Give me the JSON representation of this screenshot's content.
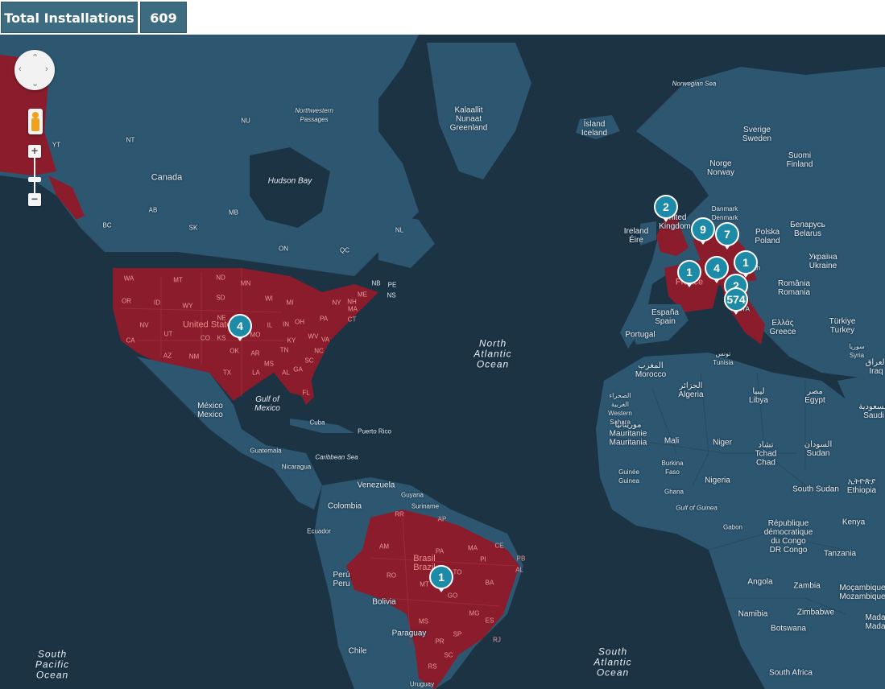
{
  "header": {
    "label": "Total Installations",
    "value": "609"
  },
  "colors": {
    "ocean": "#1c3344",
    "land": "#2d5770",
    "highlight": "#8a1c2c",
    "header_box": "#3d6c80",
    "marker": "#1d8aa8"
  },
  "map_controls": {
    "icons": [
      "pan-icon",
      "pegman-icon",
      "zoom-in-icon",
      "zoom-out-icon"
    ],
    "zoom_in": "+",
    "zoom_out": "−"
  },
  "markers": [
    {
      "name": "united-kingdom",
      "count": "2"
    },
    {
      "name": "netherlands",
      "count": "9"
    },
    {
      "name": "germany",
      "count": "7"
    },
    {
      "name": "france",
      "count": "1"
    },
    {
      "name": "switzerland",
      "count": "4"
    },
    {
      "name": "austria",
      "count": "1"
    },
    {
      "name": "italy-north",
      "count": "2"
    },
    {
      "name": "italy",
      "count": "574"
    },
    {
      "name": "united-states",
      "count": "4"
    },
    {
      "name": "brazil",
      "count": "1"
    }
  ],
  "labels": {
    "norwegian_sea": "Norwegian Sea",
    "northwestern_passages": "Northwestern\nPassages",
    "nu": "NU",
    "nt": "NT",
    "yt": "YT",
    "greenland": "Kalaallit\nNunaat\nGreenland",
    "iceland": "Ísland\nIceland",
    "sweden": "Sverige\nSweden",
    "norway": "Norge\nNorway",
    "finland": "Suomi\nFinland",
    "canada": "Canada",
    "hudson_bay": "Hudson Bay",
    "ab": "AB",
    "mb": "MB",
    "sk": "SK",
    "bc": "BC",
    "nl": "NL",
    "on": "ON",
    "qc": "QC",
    "nb": "NB",
    "pe": "PE",
    "ns": "NS",
    "denmark": "Danmark\nDenmark",
    "ireland": "Ireland\nÉire",
    "united_kingdom": "United\nKingdom",
    "poland": "Polska\nPoland",
    "belarus": "Беларусь\nBelarus",
    "ukraine": "Україна\nUkraine",
    "romania": "România\nRomania",
    "greece": "Ελλάς\nGreece",
    "turkey": "Türkiye\nTurkey",
    "spain": "España\nSpain",
    "portugal": "Portugal",
    "france": "France",
    "tunisia": "تونس\nTunisia",
    "morocco": "المغرب\nMorocco",
    "algeria": "الجزائر\nAlgeria",
    "libya": "ليبيا\nLibya",
    "egypt": "مصر\nEgypt",
    "syria": "سوريا\nSyria",
    "iraq": "العراق\nIraq",
    "saudi": "السعودية\nSaudi",
    "western_sahara": "الصحراء\nالغربية\nWestern\nSahara",
    "mauritania": "موريتانيا\nMauritanie\nMauritania",
    "mali": "Mali",
    "niger": "Niger",
    "chad": "تشاد\nTchad\nChad",
    "sudan": "السودان\nSudan",
    "ethiopia": "ኢትዮጵያ\nEthiopia",
    "south_sudan": "South Sudan",
    "guinea": "Guinée\nGuinea",
    "burkina": "Burkina\nFaso",
    "ghana": "Ghana",
    "nigeria": "Nigeria",
    "gulf_guinea": "Gulf of Guinea",
    "gabon": "Gabon",
    "drc": "République\ndémocratique\ndu Congo\nDR Congo",
    "kenya": "Kenya",
    "tanzania": "Tanzania",
    "angola": "Angola",
    "zambia": "Zambia",
    "mozambique": "Moçambique\nMozambique",
    "namibia": "Namibia",
    "zimbabwe": "Zimbabwe",
    "botswana": "Botswana",
    "madagascar": "Mada\nMada",
    "south_africa": "South Africa",
    "north_atlantic": "North\nAtlantic\nOcean",
    "south_atlantic": "South\nAtlantic\nOcean",
    "south_pacific": "South\nPacific\nOcean",
    "united_states": "United States",
    "mexico": "México\nMexico",
    "gulf_mexico": "Gulf of\nMexico",
    "cuba": "Cuba",
    "puerto_rico": "Puerto Rico",
    "guatemala": "Guatemala",
    "nicaragua": "Nicaragua",
    "caribbean": "Caribbean Sea",
    "venezuela": "Venezuela",
    "guyana": "Guyana",
    "suriname": "Suriname",
    "colombia": "Colombia",
    "ecuador": "Ecuador",
    "peru": "Perú\nPeru",
    "bolivia": "Bolivia",
    "brazil": "Brasil\nBrazil",
    "paraguay": "Paraguay",
    "chile": "Chile",
    "uruguay": "Uruguay",
    "austria_short": "ch",
    "italy_short": "ITA"
  },
  "us_states": [
    "WA",
    "OR",
    "ID",
    "MT",
    "ND",
    "MN",
    "SD",
    "WY",
    "NV",
    "UT",
    "CA",
    "AZ",
    "NM",
    "CO",
    "NE",
    "KS",
    "OK",
    "TX",
    "IA",
    "MO",
    "AR",
    "LA",
    "WI",
    "IL",
    "MS",
    "MI",
    "IN",
    "KY",
    "TN",
    "AL",
    "GA",
    "OH",
    "WV",
    "VA",
    "NC",
    "SC",
    "FL",
    "PA",
    "NY",
    "ME",
    "NH",
    "MA",
    "CT"
  ],
  "br_states": [
    "RR",
    "AP",
    "AM",
    "PA",
    "MA",
    "CE",
    "PB",
    "PI",
    "AL",
    "TO",
    "BA",
    "RO",
    "MT",
    "GO",
    "MG",
    "MS",
    "SP",
    "ES",
    "PR",
    "SC",
    "RS",
    "RJ"
  ]
}
